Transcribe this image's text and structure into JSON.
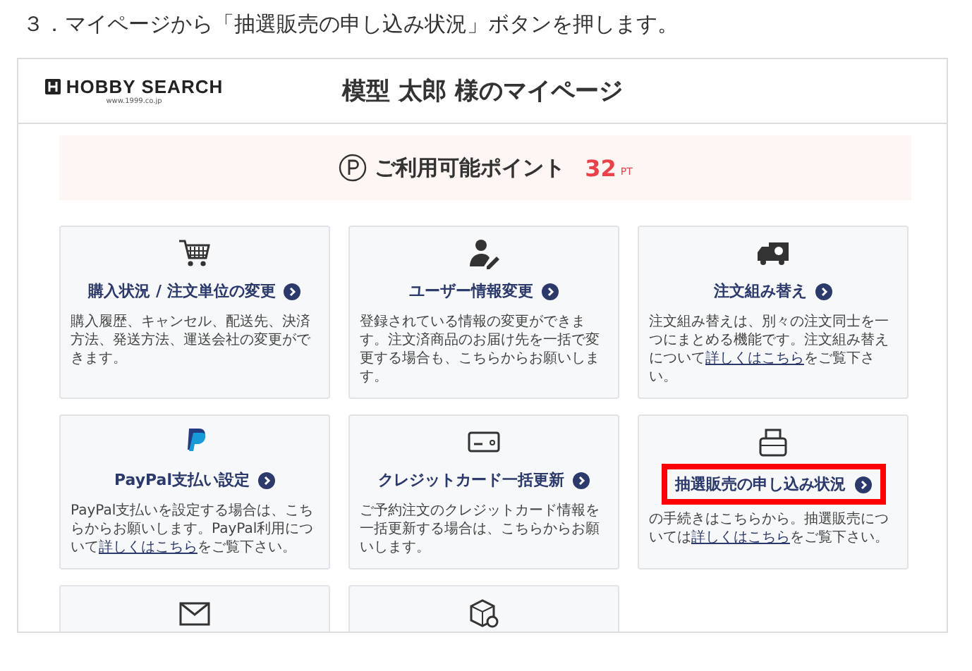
{
  "instruction": "３．マイページから「抽選販売の申し込み状況」ボタンを押します。",
  "header": {
    "logo": "HOBBY SEARCH",
    "logo_url": "www.1999.co.jp",
    "title": "模型 太郎 様のマイページ"
  },
  "points": {
    "label": "ご利用可能ポイント",
    "value": "32",
    "unit": "PT"
  },
  "cards": [
    {
      "kind": "cart",
      "title": "購入状況 / 注文単位の変更",
      "highlighted": false,
      "description": [
        {
          "text": "購入履歴、キャンセル、配送先、決済方法、発送方法、運送会社の変更ができます。",
          "link": false
        }
      ]
    },
    {
      "kind": "user",
      "title": "ユーザー情報変更",
      "highlighted": false,
      "description": [
        {
          "text": "登録されている情報の変更ができます。注文済商品のお届け先を一括で変更する場合も、こちらからお願いします。",
          "link": false
        }
      ]
    },
    {
      "kind": "truck",
      "title": "注文組み替え",
      "highlighted": false,
      "description": [
        {
          "text": "注文組み替えは、別々の注文同士を一つにまとめる機能です。注文組み替えについて",
          "link": false
        },
        {
          "text": "詳しくはこちら",
          "link": true
        },
        {
          "text": "をご覧下さい。",
          "link": false
        }
      ]
    },
    {
      "kind": "paypal",
      "title": "PayPal支払い設定",
      "highlighted": false,
      "description": [
        {
          "text": "PayPal支払いを設定する場合は、こちらからお願いします。PayPal利用について",
          "link": false
        },
        {
          "text": "詳しくはこちら",
          "link": true
        },
        {
          "text": "をご覧下さい。",
          "link": false
        }
      ]
    },
    {
      "kind": "card",
      "title": "クレジットカード一括更新",
      "highlighted": false,
      "description": [
        {
          "text": "ご予約注文のクレジットカード情報を一括更新する場合は、こちらからお願いします。",
          "link": false
        }
      ]
    },
    {
      "kind": "printer",
      "title": "抽選販売の申し込み状況",
      "highlighted": true,
      "description": [
        {
          "text": "の手続きはこちらから。抽選販売については",
          "link": false
        },
        {
          "text": "詳しくはこちら",
          "link": true
        },
        {
          "text": "をご覧下さい。",
          "link": false
        }
      ]
    },
    {
      "kind": "mail"
    },
    {
      "kind": "package"
    }
  ]
}
